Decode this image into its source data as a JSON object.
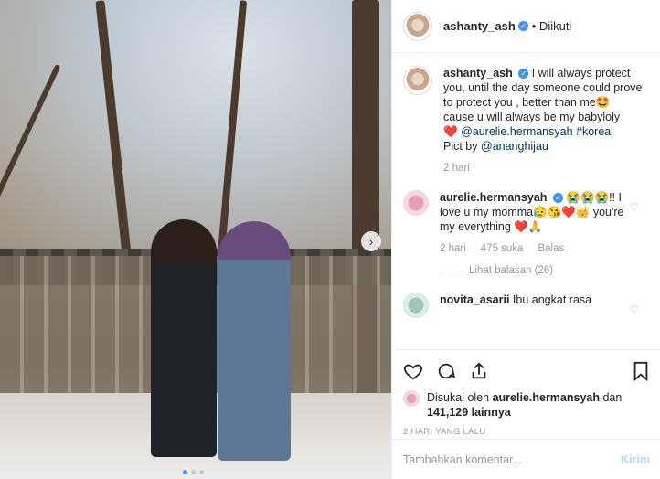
{
  "post": {
    "author": "ashanty_ash",
    "follow_status": "• Diikuti",
    "image_alt": "Two girls standing in front of a traditional Korean wall under bare trees",
    "carousel": {
      "count": 3,
      "active": 1
    }
  },
  "caption": {
    "username": "ashanty_ash",
    "line1": "I will always protect you, until the day someone could prove to protect you , better than me🤩",
    "line2": "cause u will always be my babyloly",
    "line3_heart": "❤️",
    "line3_mention": "@aurelie.hermansyah",
    "line3_tag": "#korea",
    "line4_prefix": "Pict by",
    "line4_mention": "@ananghijau",
    "time": "2 hari"
  },
  "comments": [
    {
      "username": "aurelie.hermansyah",
      "text": "😭😭😭!! I love u my momma😥😘❤️👑 you're my everything ❤️🙏",
      "time": "2 hari",
      "likes": "475 suka",
      "reply_label": "Balas",
      "view_replies": "Lihat balasan (26)"
    },
    {
      "username": "novita_asarii",
      "text": "Ibu angkat rasa"
    }
  ],
  "actions": {
    "liked_by_prefix": "Disukai oleh",
    "liked_by_user": "aurelie.hermansyah",
    "liked_by_suffix": "dan",
    "others": "141,129 lainnya",
    "ago": "2 HARI YANG LALU"
  },
  "input": {
    "placeholder": "Tambahkan komentar...",
    "send_label": "Kirim"
  },
  "icons": {
    "like": "heart-icon",
    "comment": "comment-icon",
    "share": "share-icon",
    "save": "bookmark-icon"
  }
}
